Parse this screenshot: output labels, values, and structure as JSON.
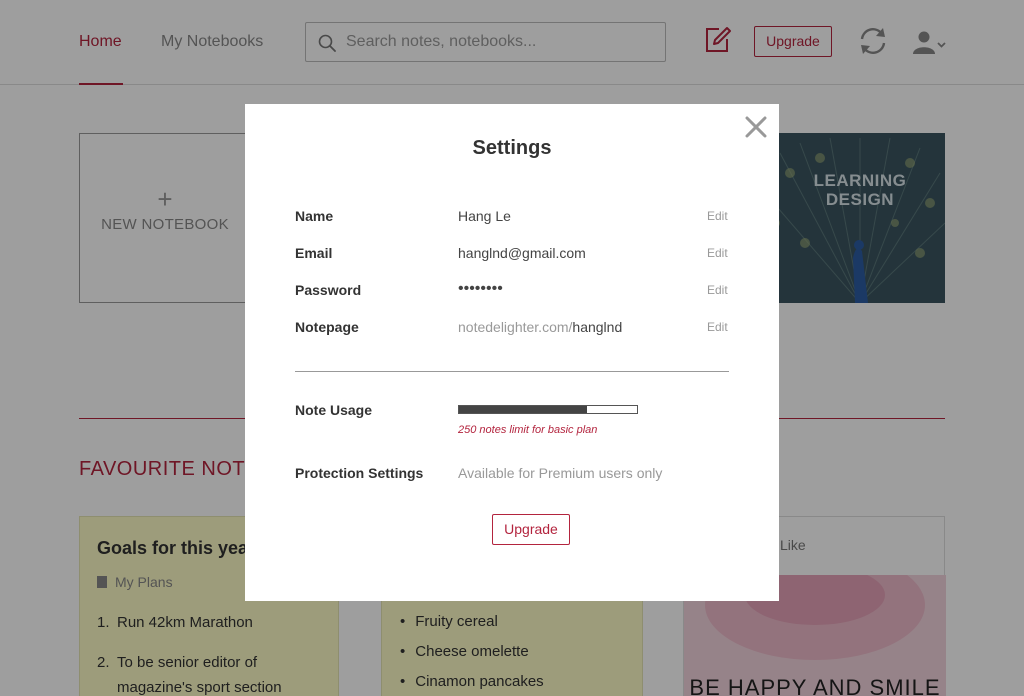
{
  "nav": {
    "home": "Home",
    "notebooks": "My Notebooks",
    "search_placeholder": "Search notes, notebooks...",
    "upgrade": "Upgrade"
  },
  "background": {
    "new_notebook": {
      "plus": "+",
      "label": "NEW NOTEBOOK"
    },
    "learning_card": {
      "label": "LEARNING DESIGN"
    },
    "favourites_title": "FAVOURITE NOTE",
    "notes": [
      {
        "title": "Goals for this year",
        "notebook": "My Plans",
        "items": [
          {
            "num": "1.",
            "text": "Run 42km Marathon"
          },
          {
            "num": "2.",
            "text": "To be senior editor of magazine's  sport section"
          }
        ]
      },
      {
        "items": [
          "Fruity cereal",
          "Cheese omelette",
          "Cinamon pancakes"
        ]
      },
      {
        "like": "Like",
        "image_text": "BE HAPPY AND SMILE"
      }
    ]
  },
  "settings": {
    "title": "Settings",
    "rows": [
      {
        "label": "Name",
        "value": "Hang Le",
        "edit": "Edit"
      },
      {
        "label": "Email",
        "value": "hanglnd@gmail.com",
        "edit": "Edit"
      },
      {
        "label": "Password",
        "value": "••••••••",
        "edit": "Edit"
      },
      {
        "label": "Notepage",
        "value_prefix": "notedelighter.com/",
        "value": "hanglnd",
        "edit": "Edit"
      }
    ],
    "note_usage": {
      "label": "Note Usage",
      "fraction": 0.72,
      "note": "250 notes limit for basic plan"
    },
    "protection": {
      "label": "Protection Settings",
      "value": "Available for Premium users only"
    },
    "upgrade": "Upgrade"
  },
  "colors": {
    "accent": "#b3243e",
    "overlay": "rgba(0,0,0,0.38)"
  },
  "icons": {
    "search": "search-icon",
    "compose": "compose-icon",
    "sync": "sync-icon",
    "account": "user-icon",
    "close": "close-icon"
  }
}
